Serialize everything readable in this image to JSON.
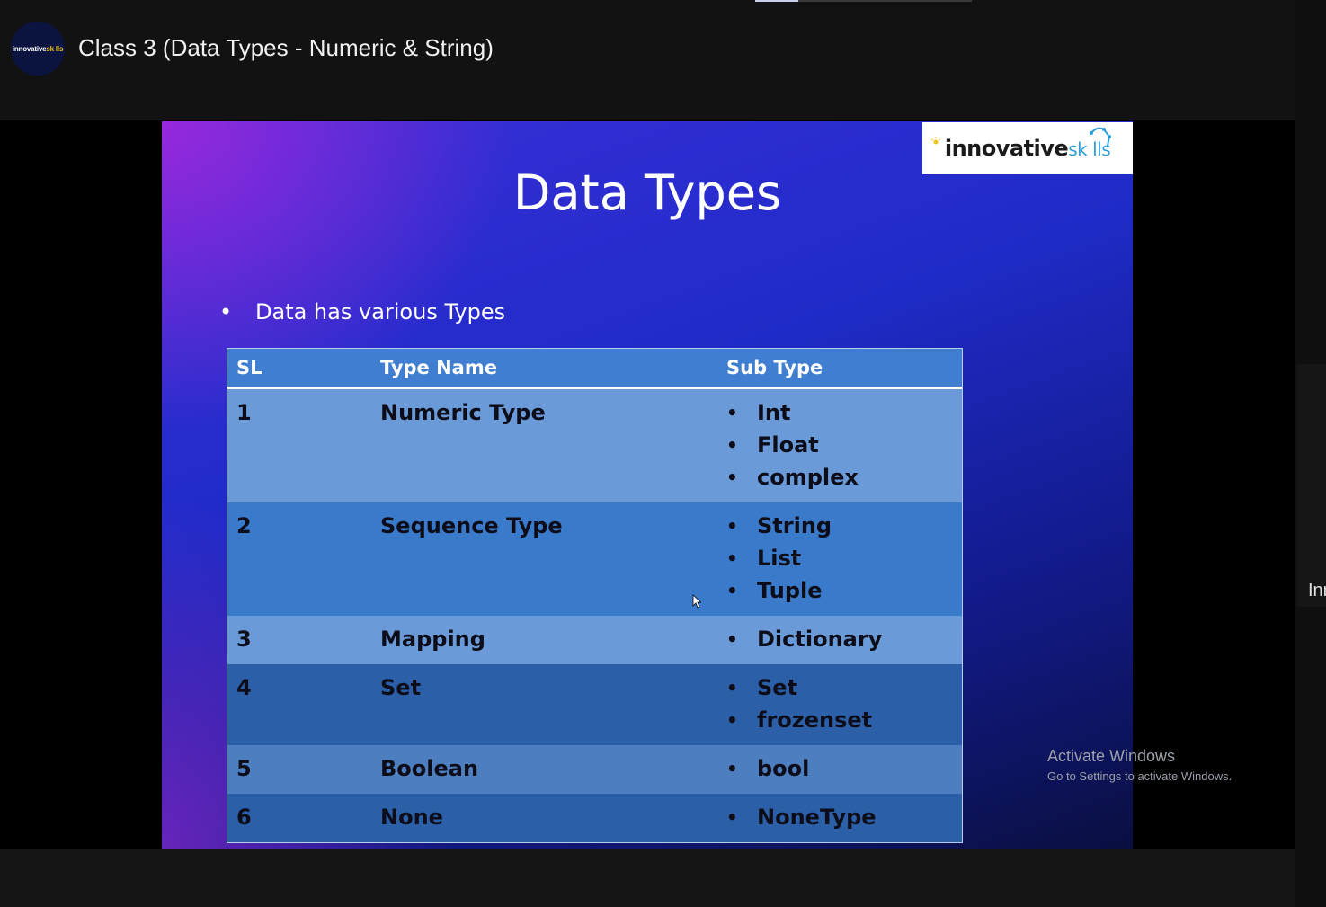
{
  "video": {
    "title": "Class 3 (Data Types - Numeric & String)",
    "channel_logo": {
      "main": "innovative",
      "accent": "sk lls"
    }
  },
  "slide": {
    "title": "Data Types",
    "logo": {
      "main": "innovative",
      "accent": "sk lls"
    },
    "bullet": "Data has various Types",
    "table": {
      "headers": [
        "SL",
        "Type Name",
        "Sub Type"
      ],
      "rows": [
        {
          "sl": "1",
          "name": "Numeric Type",
          "subtypes": [
            "Int",
            "Float",
            "complex"
          ]
        },
        {
          "sl": "2",
          "name": "Sequence Type",
          "subtypes": [
            "String",
            "List",
            "Tuple"
          ]
        },
        {
          "sl": "3",
          "name": "Mapping",
          "subtypes": [
            "Dictionary"
          ]
        },
        {
          "sl": "4",
          "name": "Set",
          "subtypes": [
            "Set",
            "frozenset"
          ]
        },
        {
          "sl": "5",
          "name": "Boolean",
          "subtypes": [
            "bool"
          ]
        },
        {
          "sl": "6",
          "name": "None",
          "subtypes": [
            "NoneType"
          ]
        }
      ]
    }
  },
  "overlay": {
    "activate_title": "Activate Windows",
    "activate_sub": "Go to Settings to activate Windows.",
    "side_text": "Inn"
  },
  "colors": {
    "row_light": "#6a9bd8",
    "row_dark": "#3a7acb",
    "row_light_bottom": "#4d7fc0",
    "row_dark_bottom": "#2b5fa8",
    "header": "#3f7ed0"
  }
}
